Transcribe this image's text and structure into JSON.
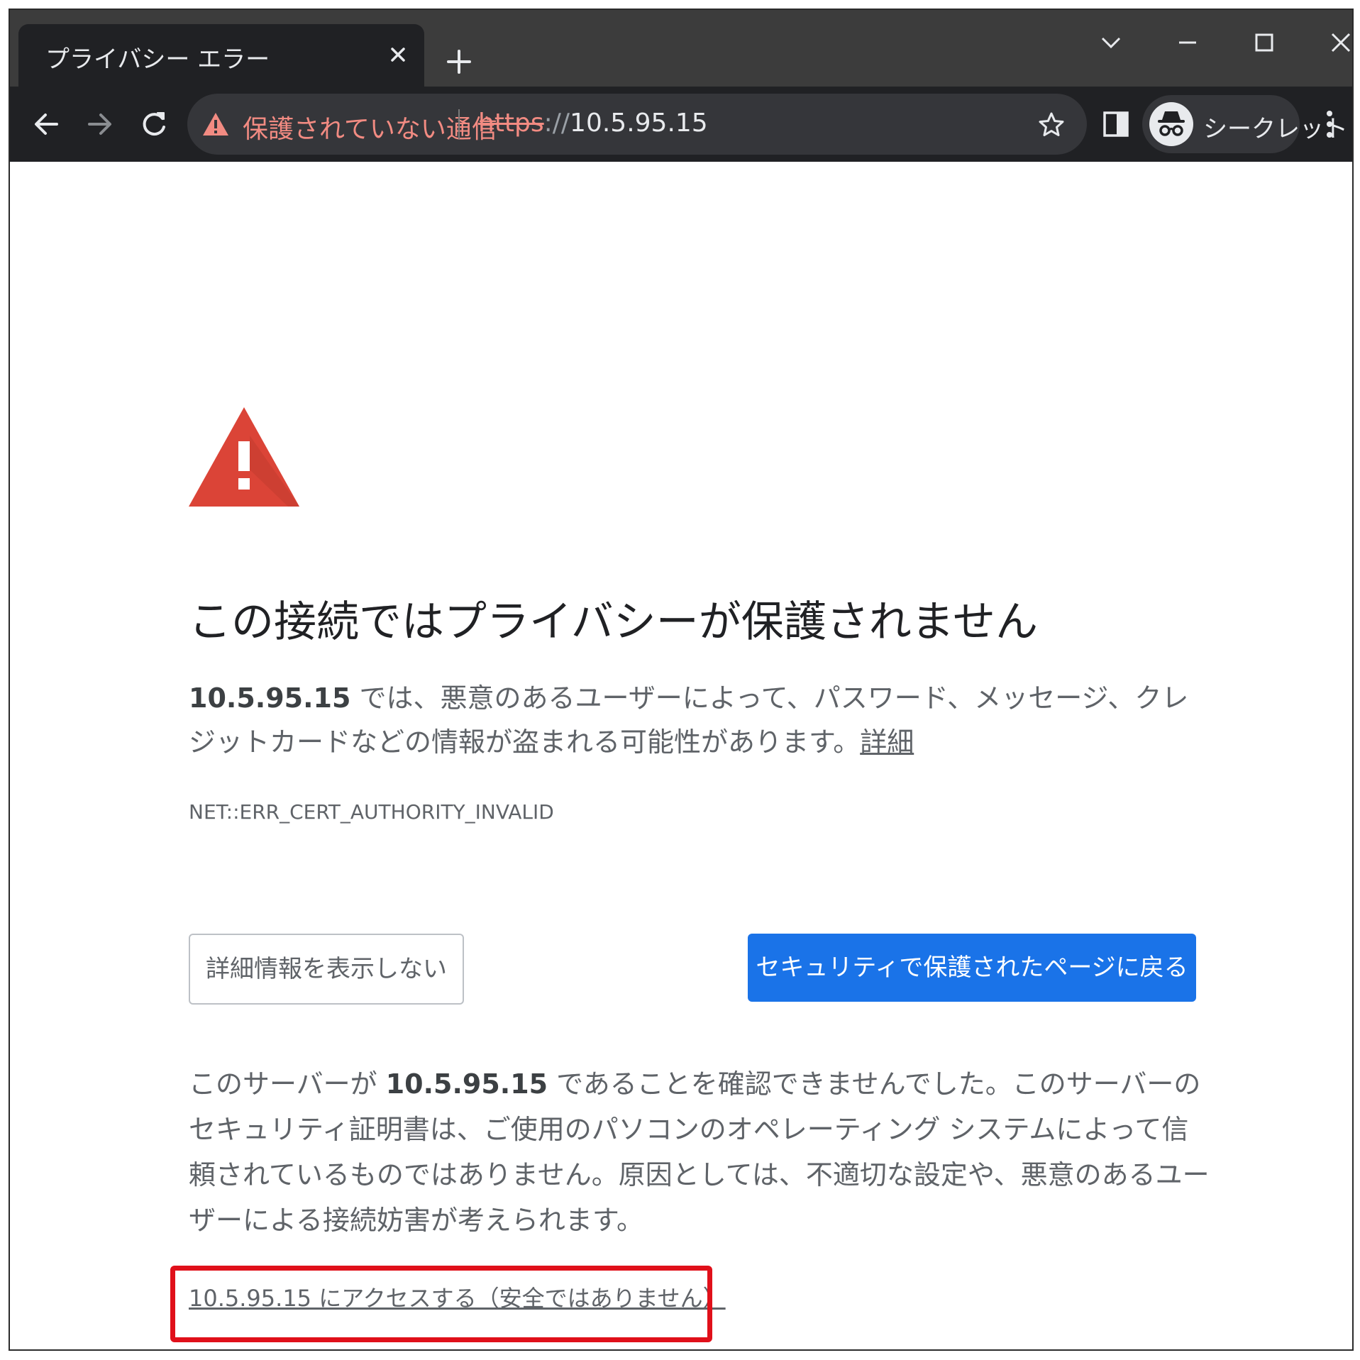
{
  "tab": {
    "title": "プライバシー エラー"
  },
  "omnibox": {
    "security_text": "保護されていない通信",
    "scheme": "https",
    "slashes": "://",
    "host": "10.5.95.15"
  },
  "profile": {
    "label": "シークレット"
  },
  "page": {
    "title": "この接続ではプライバシーが保護されません",
    "desc_host": "10.5.95.15",
    "desc_text": " では、悪意のあるユーザーによって、パスワード、メッセージ、クレジットカードなどの情報が盗まれる可能性があります。",
    "details_link": "詳細",
    "error_code": "NET::ERR_CERT_AUTHORITY_INVALID",
    "hide_details_button": "詳細情報を表示しない",
    "back_to_safety_button": "セキュリティで保護されたページに戻る",
    "detail_prefix": "このサーバーが ",
    "detail_host": "10.5.95.15",
    "detail_text": " であることを確認できませんでした。このサーバーのセキュリティ証明書は、ご使用のパソコンのオペレーティング システムによって信頼されているものではありません。原因としては、不適切な設定や、悪意のあるユーザーによる接続妨害が考えられます。",
    "proceed_link": "10.5.95.15 にアクセスする（安全ではありません）"
  },
  "colors": {
    "chrome_frame": "#3c3c3c",
    "toolbar": "#202124",
    "warning_red": "#db4437",
    "primary_blue": "#1a73e8",
    "highlight_red": "#e0101a"
  }
}
